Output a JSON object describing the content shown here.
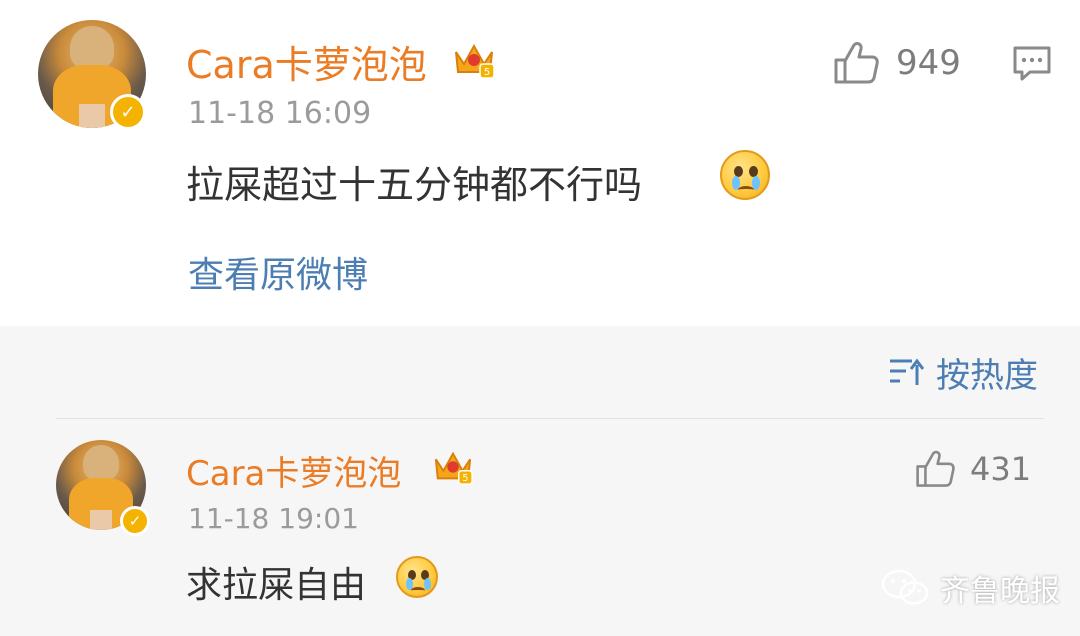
{
  "top_comment": {
    "username": "Cara卡萝泡泡",
    "timestamp": "11-18 16:09",
    "text": "拉屎超过十五分钟都不行吗",
    "likes": "949",
    "view_original_label": "查看原微博",
    "crown_level": "5"
  },
  "sort": {
    "label": "按热度"
  },
  "reply": {
    "username": "Cara卡萝泡泡",
    "timestamp": "11-18 19:01",
    "text": "求拉屎自由",
    "likes": "431",
    "crown_level": "5"
  },
  "watermark": {
    "text": "齐鲁晚报"
  },
  "colors": {
    "username": "#ea7c26",
    "link": "#4d7eb3",
    "muted": "#9b9b9b",
    "badge": "#f5b301"
  },
  "icons": [
    "thumbs-up-icon",
    "comment-icon",
    "sort-icon",
    "crown-icon",
    "verified-icon",
    "crying-emoji-icon",
    "wechat-icon"
  ]
}
